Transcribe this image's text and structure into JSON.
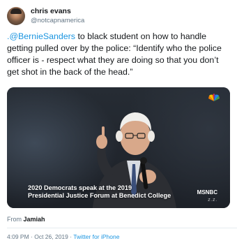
{
  "author": {
    "display_name": "chris evans",
    "handle": "@notcapnamerica"
  },
  "tweet": {
    "mention": ".@BernieSanders",
    "body": " to black student on how to handle getting pulled over by the police: “Identify who the police officer is - respect what they are doing so that you don’t get shot in the back of the head.”"
  },
  "media": {
    "caption_line1": "2020 Democrats speak at the 2019",
    "caption_line2": "Presidential Justice Forum at Benedict College",
    "network_logo": "MSNBC",
    "network_sub": "Z.Z.",
    "corner_logo": "nbc-peacock-icon"
  },
  "from": {
    "prefix": "From",
    "user": "Jamiah"
  },
  "meta": {
    "timestamp": "4:09 PM · Oct 26, 2019 · ",
    "source": "Twitter for iPhone"
  },
  "colors": {
    "link": "#1b95e0",
    "secondary_text": "#657786",
    "primary_text": "#14171a"
  }
}
